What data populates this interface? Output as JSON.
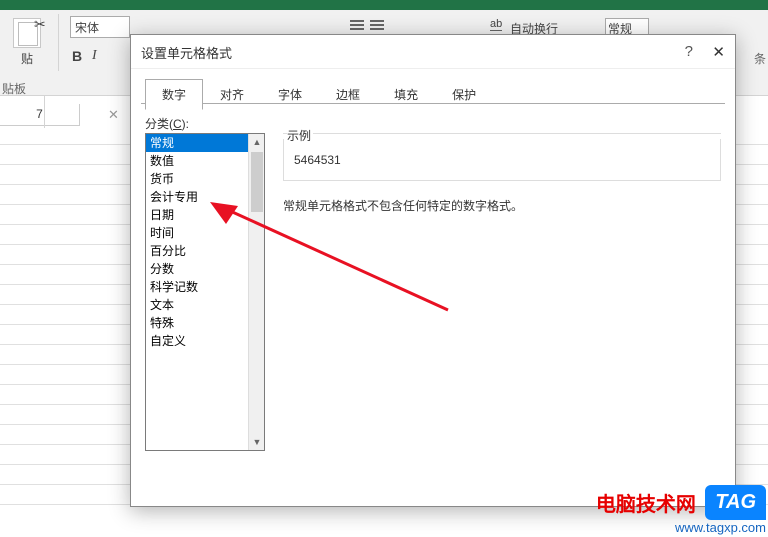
{
  "ribbon": {
    "paste_label": "贴",
    "font_name": "宋体",
    "bold": "B",
    "italic": "I",
    "clipboard_group": "贴板",
    "wrap_text": "自动换行",
    "ab": "ab",
    "format_combo": "常规",
    "strip": "条"
  },
  "namebox": "7",
  "dialog": {
    "title": "设置单元格格式",
    "help": "?",
    "close": "✕",
    "tabs": [
      "数字",
      "对齐",
      "字体",
      "边框",
      "填充",
      "保护"
    ],
    "active_tab": 0,
    "category_label_prefix": "分类(",
    "category_label_key": "C",
    "category_label_suffix": "):",
    "categories": [
      "常规",
      "数值",
      "货币",
      "会计专用",
      "日期",
      "时间",
      "百分比",
      "分数",
      "科学记数",
      "文本",
      "特殊",
      "自定义"
    ],
    "selected_category": 0,
    "sample_label": "示例",
    "sample_value": "5464531",
    "description": "常规单元格格式不包含任何特定的数字格式。"
  },
  "watermark": {
    "cn": "电脑技术网",
    "url": "www.tagxp.com",
    "tag": "TAG"
  }
}
